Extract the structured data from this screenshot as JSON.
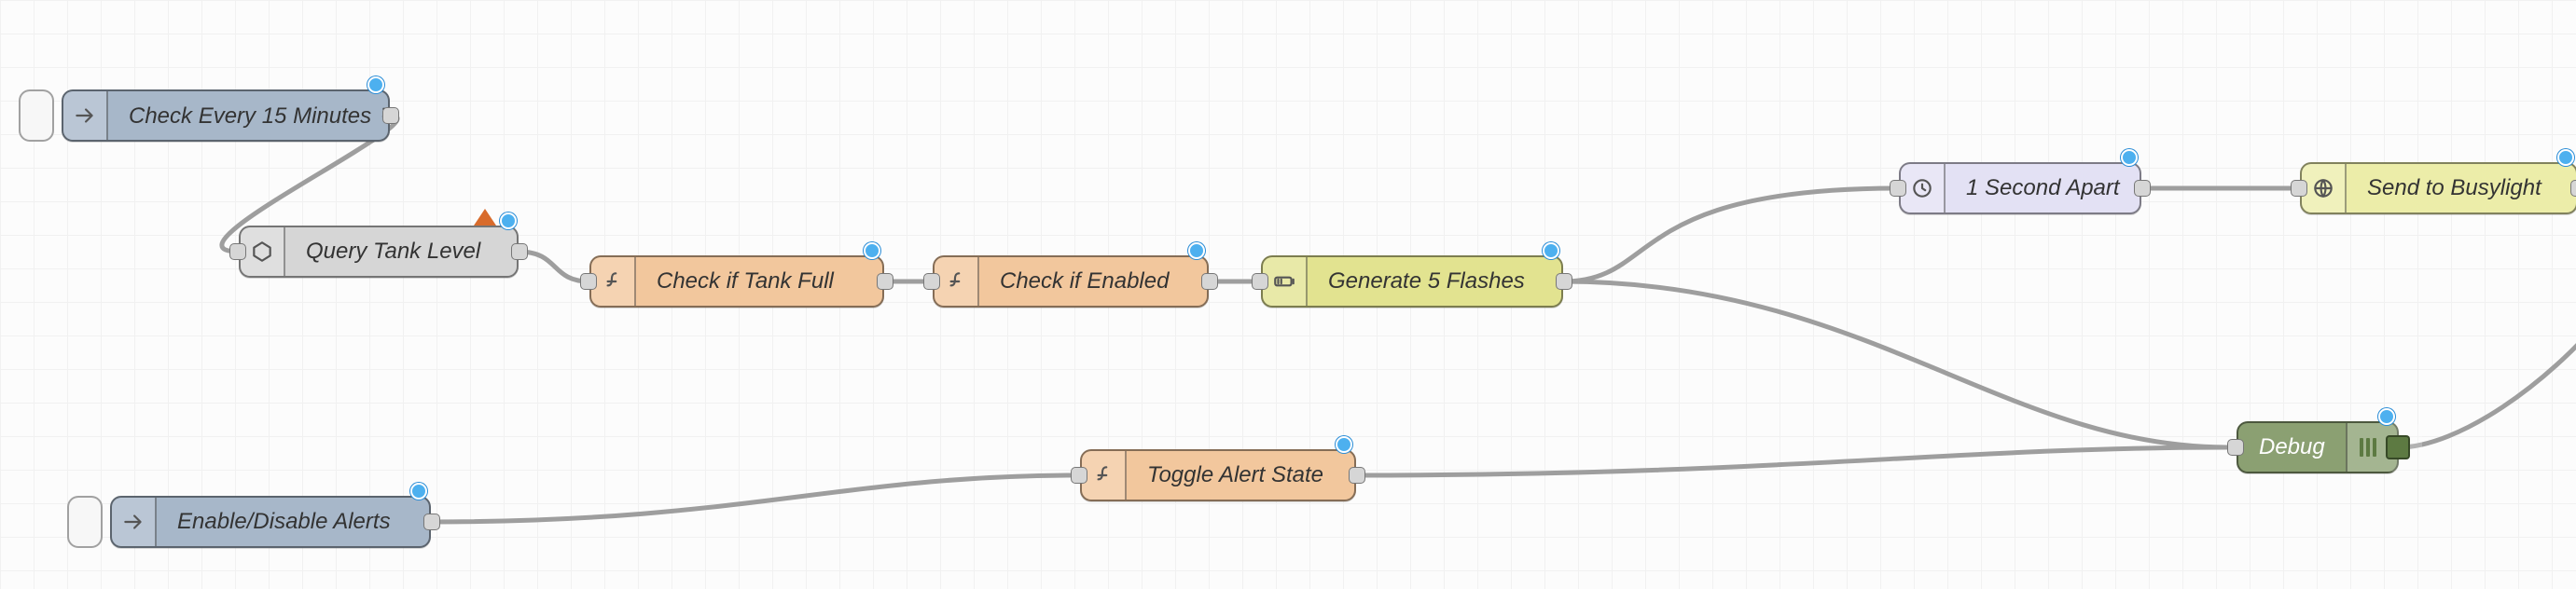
{
  "nodes": {
    "check_interval": {
      "label": "Check Every 15 Minutes ↻"
    },
    "query_tank": {
      "label": "Query Tank Level"
    },
    "check_full": {
      "label": "Check if Tank Full"
    },
    "check_enabled": {
      "label": "Check if Enabled"
    },
    "gen_flashes": {
      "label": "Generate 5 Flashes"
    },
    "delay": {
      "label": "1 Second Apart"
    },
    "busylight": {
      "label": "Send to Busylight"
    },
    "toggle": {
      "label": "Toggle Alert State"
    },
    "enable_disable": {
      "label": "Enable/Disable Alerts"
    },
    "debug": {
      "label": "Debug"
    }
  },
  "colors": {
    "inject": "#a7b7c9",
    "api": "#d6d6d6",
    "function": "#f2c79d",
    "generate": "#e2e390",
    "delay": "#e3e1f4",
    "http": "#eceda9",
    "debug": "#8ba072",
    "port_dot": "#4db0ef",
    "error_tri": "#d86b2b",
    "wire": "#9e9e9e"
  },
  "edges": [
    [
      "check_interval",
      "query_tank"
    ],
    [
      "query_tank",
      "check_full"
    ],
    [
      "check_full",
      "check_enabled"
    ],
    [
      "check_enabled",
      "gen_flashes"
    ],
    [
      "gen_flashes",
      "delay"
    ],
    [
      "gen_flashes",
      "debug"
    ],
    [
      "delay",
      "busylight"
    ],
    [
      "busylight",
      "debug"
    ],
    [
      "enable_disable",
      "toggle"
    ],
    [
      "toggle",
      "debug"
    ]
  ]
}
